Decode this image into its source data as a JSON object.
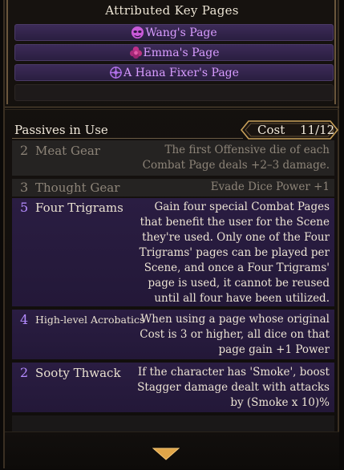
{
  "key_pages": {
    "title": "Attributed Key Pages",
    "items": [
      {
        "label": "Wang's Page",
        "icon": "mask-icon"
      },
      {
        "label": "Emma's Page",
        "icon": "flower-icon"
      },
      {
        "label": "A Hana Fixer's Page",
        "icon": "hana-emblem-icon"
      },
      {
        "label": "",
        "icon": ""
      }
    ]
  },
  "passives": {
    "title": "Passives in Use",
    "cost_label": "Cost",
    "cost_value": "11/12",
    "rows": [
      {
        "cost": "2",
        "name": "Meat Gear",
        "desc": [
          "The first Offensive die of each",
          "Combat Page deals +2–3 damage."
        ],
        "state": "inactive"
      },
      {
        "cost": "3",
        "name": "Thought Gear",
        "desc": [
          "Evade Dice Power +1"
        ],
        "state": "inactive"
      },
      {
        "cost": "5",
        "name": "Four Trigrams",
        "desc": [
          "Gain four special Combat Pages",
          "that benefit the user for the Scene",
          "they're used. Only one of the Four",
          "Trigrams' pages can be played per",
          "Scene, and once a Four Trigrams'",
          "page is used, it cannot be reused",
          "until all four have been utilized."
        ],
        "state": "active"
      },
      {
        "cost": "4",
        "name": "High-level Acrobatics",
        "desc": [
          "When using a page whose original",
          "Cost is 3 or higher, all dice on that",
          "page gain +1 Power"
        ],
        "state": "active"
      },
      {
        "cost": "2",
        "name": "Sooty Thwack",
        "desc": [
          "If the character has 'Smoke', boost",
          "Stagger damage dealt with attacks",
          "by (Smoke x 10)%"
        ],
        "state": "active"
      }
    ]
  },
  "colors": {
    "accent_purple": "#b58cff",
    "key_page_text": "#d89cff",
    "frame_gold": "#c9a15a"
  }
}
